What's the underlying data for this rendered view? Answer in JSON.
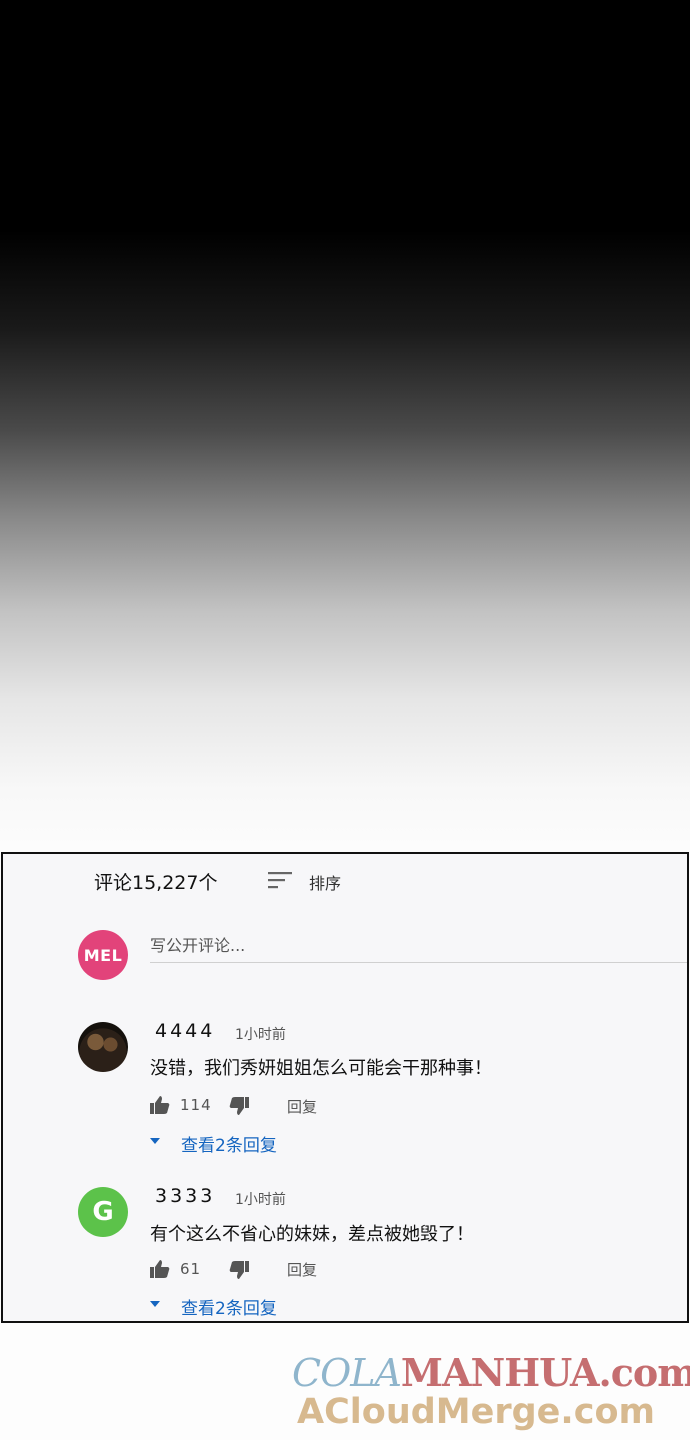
{
  "comments_header": {
    "count_label": "评论15,227个",
    "sort_label": "排序"
  },
  "compose": {
    "avatar_text": "MEL",
    "placeholder": "写公开评论..."
  },
  "comments": [
    {
      "username": "4444",
      "time": "1小时前",
      "text": "没错，我们秀妍姐姐怎么可能会干那种事！",
      "likes": "114",
      "reply_label": "回复",
      "view_replies": "查看2条回复"
    },
    {
      "avatar_text": "G",
      "username": "3333",
      "time": "1小时前",
      "text": "有个这么不省心的妹妹，差点被她毁了！",
      "likes": "61",
      "reply_label": "回复",
      "view_replies": "查看2条回复"
    }
  ],
  "watermark": {
    "line1_a": "COLA",
    "line1_b": "MANHUA.com",
    "line2": "ACloudMerge.com"
  },
  "colors": {
    "accent_blue": "#1565c0",
    "mel_pink": "#e2437a",
    "g_green": "#5cc24a"
  }
}
